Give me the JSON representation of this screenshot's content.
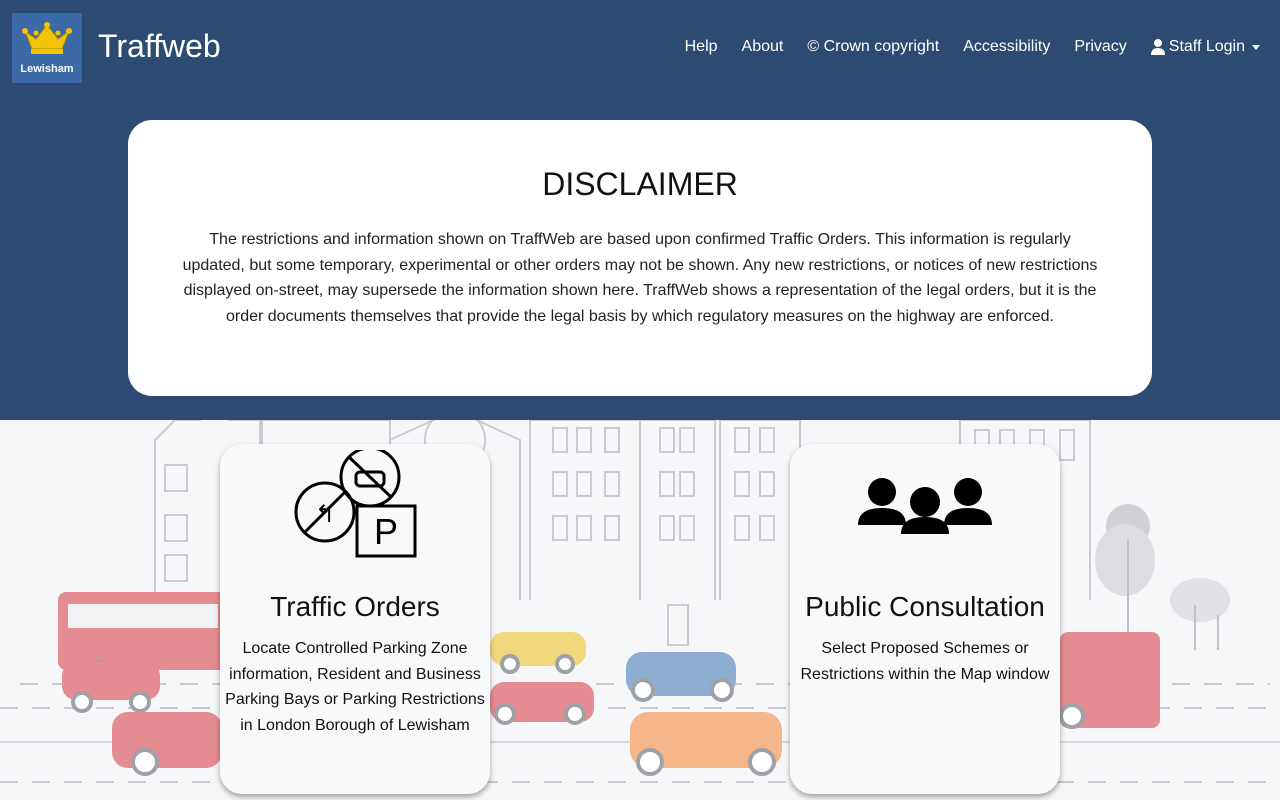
{
  "header": {
    "logo_text": "Lewisham",
    "brand": "Traffweb",
    "nav": [
      "Help",
      "About",
      "© Crown copyright",
      "Accessibility",
      "Privacy"
    ],
    "staff_login": "Staff Login"
  },
  "disclaimer": {
    "title": "DISCLAIMER",
    "text": "The restrictions and information shown on TraffWeb are based upon confirmed Traffic Orders. This information is regularly updated, but some temporary, experimental or other orders may not be shown. Any new restrictions, or notices of new restrictions displayed on-street, may supersede the information shown here. TraffWeb shows a representation of the legal orders, but it is the order documents themselves that provide the legal basis by which regulatory measures on the highway are enforced."
  },
  "cards": [
    {
      "title": "Traffic Orders",
      "text": "Locate Controlled Parking Zone information, Resident and Business Parking Bays or Parking Restrictions in London Borough of Lewisham",
      "icon": "traffic-signs-icon"
    },
    {
      "title": "Public Consultation",
      "text": "Select Proposed Schemes or Restrictions within the Map window",
      "icon": "group-icon"
    }
  ],
  "colors": {
    "header_bg": "#2c4a72",
    "logo_bg": "#3c6aa6",
    "page_bg": "#f6f7f9"
  }
}
